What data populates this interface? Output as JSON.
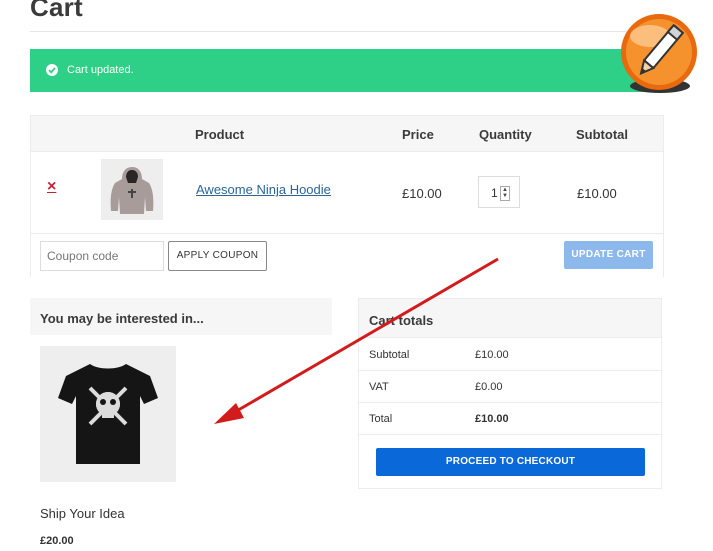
{
  "page": {
    "title": "Cart"
  },
  "notice": {
    "message": "Cart updated.",
    "color": "#2ecf87"
  },
  "cart_table": {
    "headers": {
      "product": "Product",
      "price": "Price",
      "quantity": "Quantity",
      "subtotal": "Subtotal"
    },
    "items": [
      {
        "remove": "×",
        "name": "Awesome Ninja Hoodie",
        "price": "£10.00",
        "quantity": "1",
        "subtotal": "£10.00"
      }
    ],
    "coupon_placeholder": "Coupon code",
    "apply_coupon": "APPLY COUPON",
    "update_cart": "UPDATE CART"
  },
  "cross_sells": {
    "heading": "You may be interested in...",
    "product": {
      "name": "Ship Your Idea",
      "price": "£20.00"
    }
  },
  "cart_totals": {
    "heading": "Cart totals",
    "rows": [
      {
        "label": "Subtotal",
        "value": "£10.00"
      },
      {
        "label": "VAT",
        "value": "£0.00"
      },
      {
        "label": "Total",
        "value": "£10.00"
      }
    ],
    "checkout_label": "PROCEED TO CHECKOUT"
  },
  "colors": {
    "accent": "#0a68d8",
    "update_button": "#8db8ec",
    "remove": "#c62035",
    "annotation_arrow": "#d21b1b"
  },
  "icons": [
    "check-circle-icon",
    "pencil-app-icon",
    "remove-icon"
  ]
}
